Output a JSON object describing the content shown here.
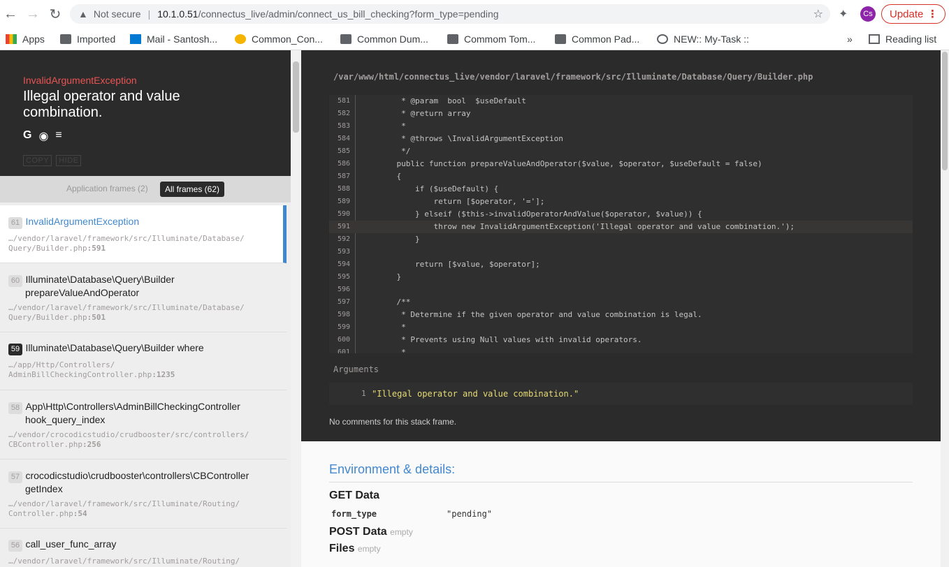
{
  "browser": {
    "security_label": "Not secure",
    "url_host": "10.1.0.51",
    "url_path": "/connectus_live/admin/connect_us_bill_checking?form_type=pending",
    "avatar_initials": "Cs",
    "update_label": "Update",
    "bookmarks": [
      "Apps",
      "Imported",
      "Mail - Santosh...",
      "Common_Con...",
      "Common Dum...",
      "Commom Tom...",
      "Common Pad...",
      "NEW:: My-Task ::"
    ],
    "more_bookmarks": "»",
    "reading_list": "Reading list"
  },
  "exception": {
    "class": "InvalidArgumentException",
    "message": "Illegal operator and value combination.",
    "icons": [
      "google-icon",
      "duckduckgo-icon",
      "stackoverflow-icon"
    ],
    "copy_label": "COPY",
    "hide_label": "HIDE"
  },
  "filters": {
    "application": "Application frames (2)",
    "all": "All frames (62)"
  },
  "frames": [
    {
      "num": "61",
      "cls": "InvalidArgumentException",
      "cls2": "",
      "file1": "…/vendor/laravel/framework/src/Illuminate/Database/",
      "file2": "Query/Builder.php",
      "line": ":591"
    },
    {
      "num": "60",
      "cls": "Illuminate\\Database\\Query\\Builder",
      "cls2": "prepareValueAndOperator",
      "file1": "…/vendor/laravel/framework/src/Illuminate/Database/",
      "file2": "Query/Builder.php",
      "line": ":501"
    },
    {
      "num": "59",
      "cls": "Illuminate\\Database\\Query\\Builder where",
      "cls2": "",
      "file1": "…/app/Http/Controllers/",
      "file2": "AdminBillCheckingController.php",
      "line": ":1235"
    },
    {
      "num": "58",
      "cls": "App\\Http\\Controllers\\AdminBillCheckingController",
      "cls2": "hook_query_index",
      "file1": "…/vendor/crocodicstudio/crudbooster/src/controllers/",
      "file2": "CBController.php",
      "line": ":256"
    },
    {
      "num": "57",
      "cls": "crocodicstudio\\crudbooster\\controllers\\CBController",
      "cls2": "getIndex",
      "file1": "…/vendor/laravel/framework/src/Illuminate/Routing/",
      "file2": "Controller.php",
      "line": ":54"
    },
    {
      "num": "56",
      "cls": "call_user_func_array",
      "cls2": "",
      "file1": "…/vendor/laravel/framework/src/Illuminate/Routing/",
      "file2": "",
      "line": ""
    }
  ],
  "code": {
    "file_path": "/var/www/html/connectus_live/vendor/laravel/framework/src/Illuminate/Database/Query/Builder.php",
    "highlight_line": "591",
    "lines": [
      {
        "n": "581",
        "t": "     * @param  bool  $useDefault"
      },
      {
        "n": "582",
        "t": "     * @return array"
      },
      {
        "n": "583",
        "t": "     *"
      },
      {
        "n": "584",
        "t": "     * @throws \\InvalidArgumentException"
      },
      {
        "n": "585",
        "t": "     */"
      },
      {
        "n": "586",
        "t": "    public function prepareValueAndOperator($value, $operator, $useDefault = false)"
      },
      {
        "n": "587",
        "t": "    {"
      },
      {
        "n": "588",
        "t": "        if ($useDefault) {"
      },
      {
        "n": "589",
        "t": "            return [$operator, '='];"
      },
      {
        "n": "590",
        "t": "        } elseif ($this->invalidOperatorAndValue($operator, $value)) {"
      },
      {
        "n": "591",
        "t": "            throw new InvalidArgumentException('Illegal operator and value combination.');"
      },
      {
        "n": "592",
        "t": "        }"
      },
      {
        "n": "593",
        "t": ""
      },
      {
        "n": "594",
        "t": "        return [$value, $operator];"
      },
      {
        "n": "595",
        "t": "    }"
      },
      {
        "n": "596",
        "t": ""
      },
      {
        "n": "597",
        "t": "    /**"
      },
      {
        "n": "598",
        "t": "     * Determine if the given operator and value combination is legal."
      },
      {
        "n": "599",
        "t": "     *"
      },
      {
        "n": "600",
        "t": "     * Prevents using Null values with invalid operators."
      },
      {
        "n": "601",
        "t": "     *"
      }
    ]
  },
  "arguments": {
    "title": "Arguments",
    "num": "1",
    "value": "\"Illegal operator and value combination.\""
  },
  "no_comments": "No comments for this stack frame.",
  "details": {
    "title": "Environment & details:",
    "get_title": "GET Data",
    "get_items": [
      {
        "key": "form_type",
        "value": "\"pending\""
      }
    ],
    "post_title": "POST Data",
    "post_empty": "empty",
    "files_title": "Files",
    "files_empty": "empty"
  }
}
